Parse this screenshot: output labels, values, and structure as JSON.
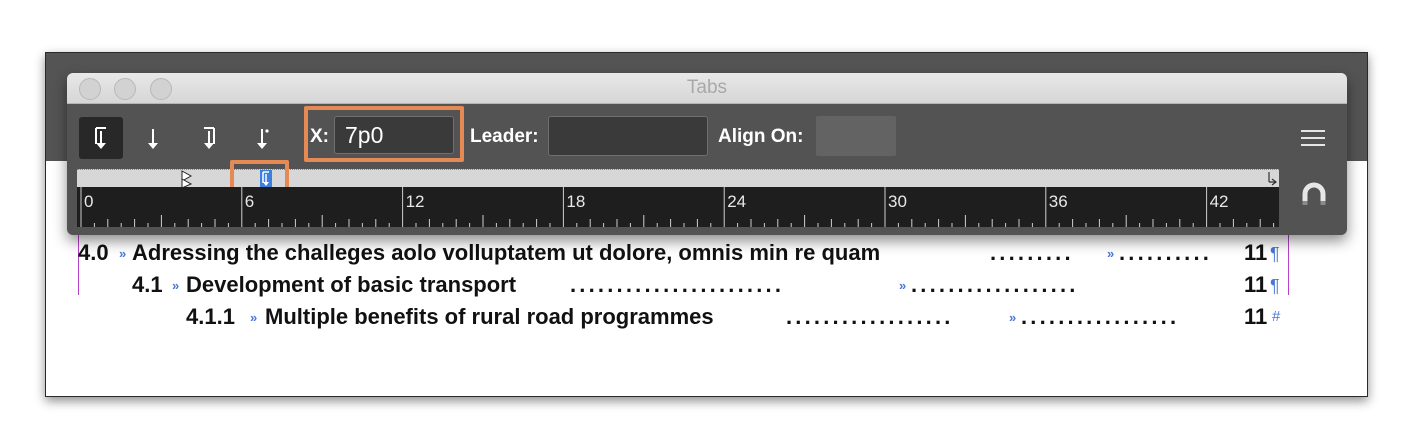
{
  "panel": {
    "title": "Tabs",
    "x_label": "X:",
    "x_value": "7p0",
    "leader_label": "Leader:",
    "leader_value": "",
    "align_on_label": "Align On:",
    "align_on_value": ""
  },
  "tab_types": [
    "left-justified-tab",
    "center-justified-tab",
    "right-justified-tab",
    "align-to-decimal-tab"
  ],
  "ruler": {
    "labels": [
      "0",
      "6",
      "12",
      "18",
      "24",
      "30",
      "36",
      "42"
    ]
  },
  "toc": [
    {
      "number": "4.0",
      "text": "Adressing the challeges aolo volluptatem ut dolore, omnis min re quam",
      "page": "11",
      "end_mark": "¶"
    },
    {
      "number": "4.1",
      "text": "Development of basic transport",
      "page": "11",
      "end_mark": "¶"
    },
    {
      "number": "4.1.1",
      "text": "Multiple benefits of rural road programmes",
      "page": "11",
      "end_mark": "#"
    }
  ],
  "colors": {
    "highlight": "#e58a55",
    "frame": "#b542c8",
    "hidden_chars": "#4a78d4"
  }
}
